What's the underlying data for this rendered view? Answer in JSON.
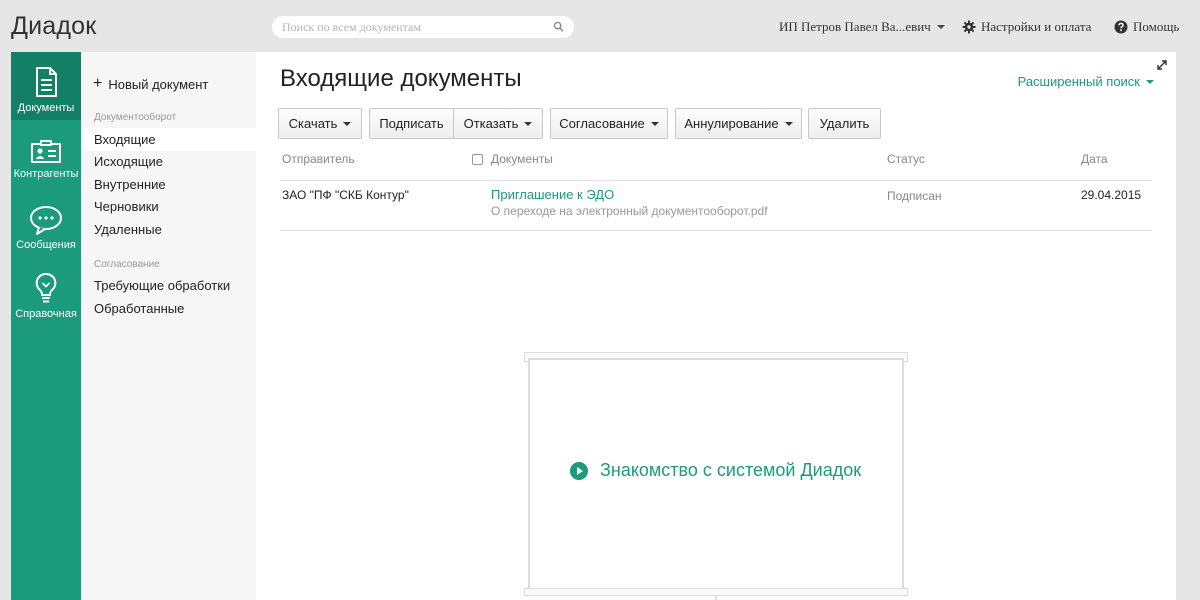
{
  "app": {
    "title": "Диадок"
  },
  "search": {
    "placeholder": "Поиск по всем документам"
  },
  "topnav": {
    "user": "ИП Петров Павел Ва...евич",
    "settings": "Настройки и оплата",
    "help": "Помощь"
  },
  "leftnav": {
    "items": [
      {
        "label": "Документы",
        "icon": "document-icon",
        "active": true
      },
      {
        "label": "Контрагенты",
        "icon": "contacts-card-icon"
      },
      {
        "label": "Сообщения",
        "icon": "chat-bubble-icon"
      },
      {
        "label": "Справочная",
        "icon": "lightbulb-icon"
      }
    ]
  },
  "sidebar": {
    "new_doc": "Новый документ",
    "section1": "Документооборот",
    "items1": [
      "Входящие",
      "Исходящие",
      "Внутренние",
      "Черновики",
      "Удаленные"
    ],
    "section2": "Согласование",
    "items2": [
      "Требующие обработки",
      "Обработанные"
    ]
  },
  "main": {
    "title": "Входящие документы",
    "advanced_search": "Расширенный поиск",
    "buttons": {
      "download": "Скачать",
      "sign": "Подписать",
      "reject": "Отказать",
      "approval": "Согласование",
      "cancel": "Аннулирование",
      "delete": "Удалить"
    },
    "columns": {
      "sender": "Отправитель",
      "documents": "Документы",
      "status": "Статус",
      "date": "Дата"
    },
    "rows": [
      {
        "sender": "ЗАО \"ПФ \"СКБ Контур\"",
        "doc_title": "Приглашение к ЭДО",
        "doc_file": "О переходе на электронный документооборот.pdf",
        "status": "Подписан",
        "date": "29.04.2015"
      }
    ],
    "video": {
      "label": "Знакомство с системой Диадок"
    }
  },
  "colors": {
    "accent": "#1b9a7c",
    "accent_dark": "#138066"
  }
}
